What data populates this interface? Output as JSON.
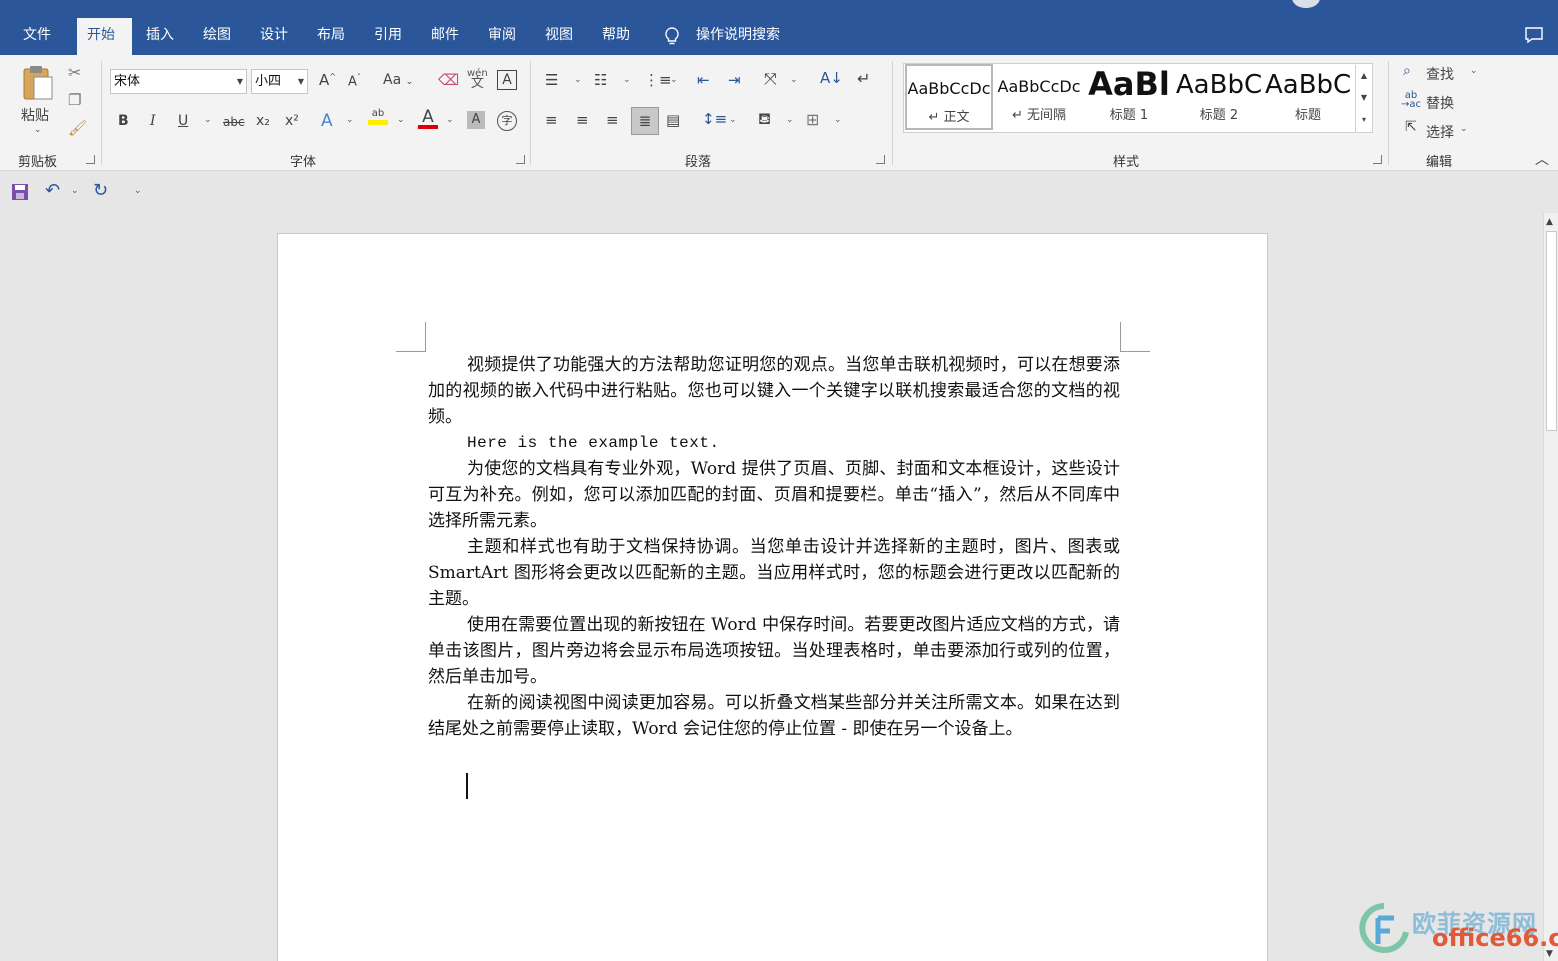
{
  "window": {
    "title": "",
    "colors": {
      "accent": "#2b579a",
      "ribbon_bg": "#f3f3f3",
      "workspace_bg": "#e6e6e6"
    }
  },
  "tabs": [
    {
      "label": "文件",
      "active": false
    },
    {
      "label": "开始",
      "active": true
    },
    {
      "label": "插入",
      "active": false
    },
    {
      "label": "绘图",
      "active": false
    },
    {
      "label": "设计",
      "active": false
    },
    {
      "label": "布局",
      "active": false
    },
    {
      "label": "引用",
      "active": false
    },
    {
      "label": "邮件",
      "active": false
    },
    {
      "label": "审阅",
      "active": false
    },
    {
      "label": "视图",
      "active": false
    },
    {
      "label": "帮助",
      "active": false
    }
  ],
  "tell_me": {
    "label": "操作说明搜索",
    "icon": "lightbulb-icon"
  },
  "ribbon": {
    "clipboard": {
      "paste_label": "粘贴",
      "group_label": "剪贴板"
    },
    "font": {
      "font_name": "宋体",
      "font_size": "小四",
      "grow_label": "A",
      "shrink_label": "A",
      "case_label": "Aa",
      "phonetic_label": "wén",
      "group_label": "字体",
      "bold": "B",
      "italic": "I",
      "underline": "U",
      "strike": "abc",
      "subscript": "x₂",
      "superscript": "x²",
      "highlight_label": "ab",
      "font_color_label": "A",
      "shading_label": "A",
      "enclose_label": "字"
    },
    "paragraph": {
      "group_label": "段落"
    },
    "styles": {
      "group_label": "样式",
      "items": [
        {
          "sample": "AaBbCcDc",
          "name": "↵ 正文"
        },
        {
          "sample": "AaBbCcDc",
          "name": "↵ 无间隔"
        },
        {
          "sample": "AaBl",
          "name": "标题 1"
        },
        {
          "sample": "AaBbC",
          "name": "标题 2"
        },
        {
          "sample": "AaBbC",
          "name": "标题"
        }
      ]
    },
    "editing": {
      "group_label": "编辑",
      "find_label": "查找",
      "replace_label": "替换",
      "select_label": "选择"
    }
  },
  "document": {
    "paragraphs": [
      "视频提供了功能强大的方法帮助您证明您的观点。当您单击联机视频时，可以在想要添加的视频的嵌入代码中进行粘贴。您也可以键入一个关键字以联机搜索最适合您的文档的视频。",
      "Here is the example text.",
      "为使您的文档具有专业外观，Word 提供了页眉、页脚、封面和文本框设计，这些设计可互为补充。例如，您可以添加匹配的封面、页眉和提要栏。单击“插入”，然后从不同库中选择所需元素。",
      "主题和样式也有助于文档保持协调。当您单击设计并选择新的主题时，图片、图表或 SmartArt 图形将会更改以匹配新的主题。当应用样式时，您的标题会进行更改以匹配新的主题。",
      "使用在需要位置出现的新按钮在 Word 中保存时间。若要更改图片适应文档的方式，请单击该图片，图片旁边将会显示布局选项按钮。当处理表格时，单击要添加行或列的位置，然后单击加号。",
      "在新的阅读视图中阅读更加容易。可以折叠文档某些部分并关注所需文本。如果在达到结尾处之前需要停止读取，Word 会记住您的停止位置 - 即使在另一个设备上。"
    ]
  },
  "watermark": {
    "cn": "欧菲资源网",
    "en": "office66.cn"
  }
}
